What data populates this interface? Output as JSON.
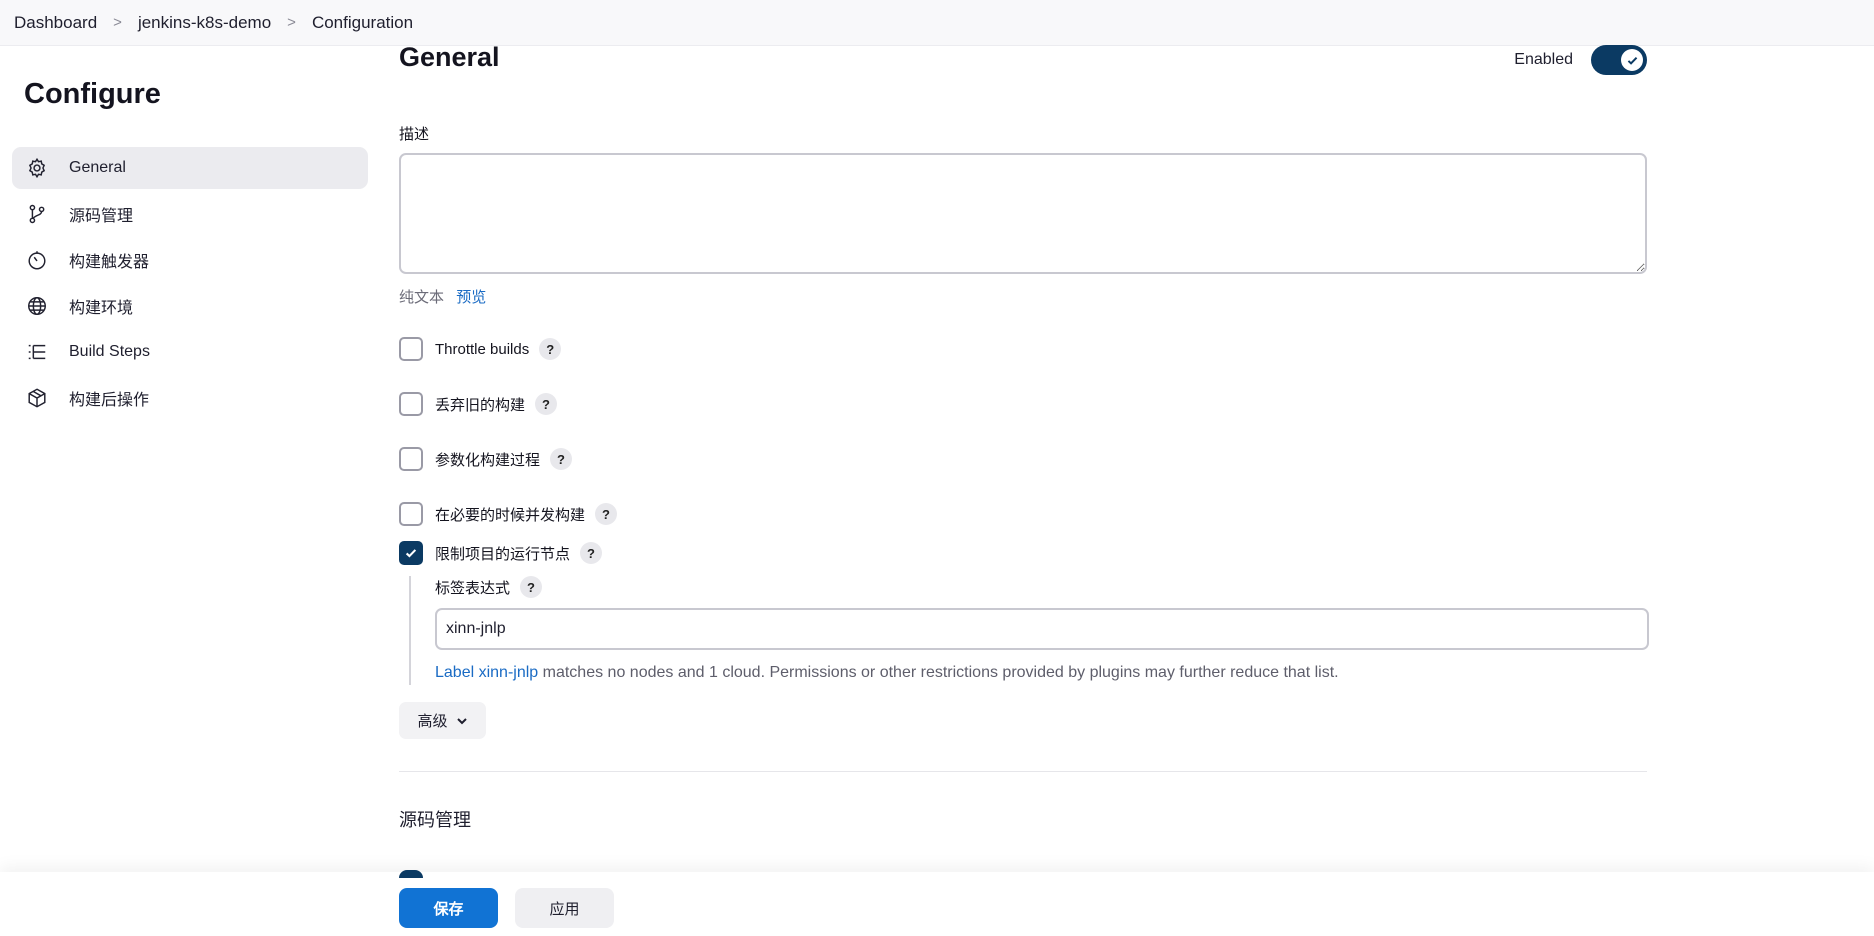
{
  "breadcrumb": {
    "items": [
      "Dashboard",
      "jenkins-k8s-demo",
      "Configuration"
    ],
    "separator": ">"
  },
  "sidebar": {
    "title": "Configure",
    "items": [
      {
        "label": "General",
        "icon": "gear-icon",
        "active": true
      },
      {
        "label": "源码管理",
        "icon": "branch-icon",
        "active": false
      },
      {
        "label": "构建触发器",
        "icon": "timer-icon",
        "active": false
      },
      {
        "label": "构建环境",
        "icon": "globe-icon",
        "active": false
      },
      {
        "label": "Build Steps",
        "icon": "list-icon",
        "active": false
      },
      {
        "label": "构建后操作",
        "icon": "package-icon",
        "active": false
      }
    ]
  },
  "general": {
    "title": "General",
    "enabled_label": "Enabled",
    "enabled": true,
    "description_label": "描述",
    "description_value": "",
    "plain_text": "纯文本",
    "preview": "预览",
    "help_glyph": "?",
    "options": [
      {
        "label": "Throttle builds",
        "checked": false
      },
      {
        "label": "丢弃旧的构建",
        "checked": false
      },
      {
        "label": "参数化构建过程",
        "checked": false
      },
      {
        "label": "在必要的时候并发构建",
        "checked": false
      },
      {
        "label": "限制项目的运行节点",
        "checked": true
      }
    ],
    "label_expression": {
      "label": "标签表达式",
      "value": "xinn-jnlp",
      "note_link": "Label xinn-jnlp",
      "note_text": " matches no nodes and 1 cloud. Permissions or other restrictions provided by plugins may further reduce that list."
    },
    "advanced_label": "高级"
  },
  "scm": {
    "title": "源码管理"
  },
  "footer": {
    "save_label": "保存",
    "apply_label": "应用"
  },
  "colors": {
    "accent": "#1173d4",
    "toggle_on": "#0b3a63",
    "link": "#1a6bc4"
  }
}
